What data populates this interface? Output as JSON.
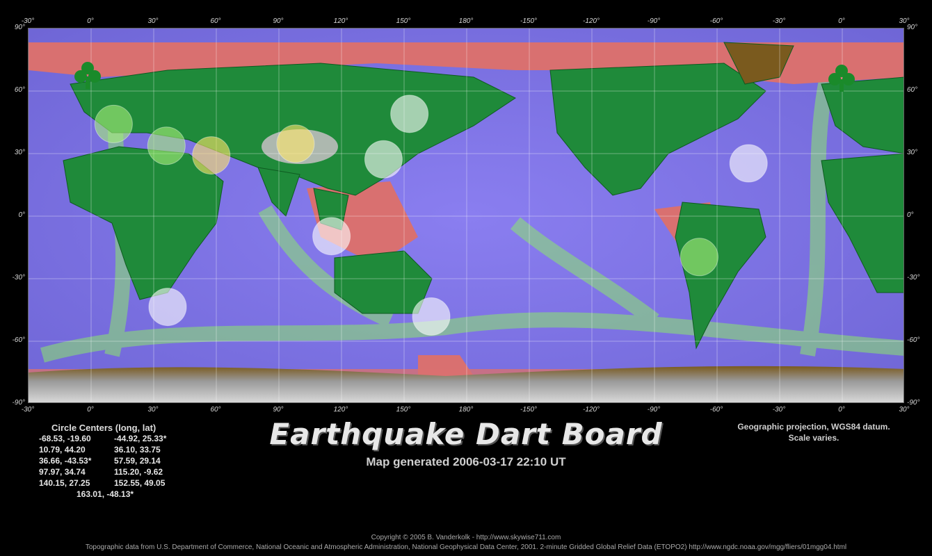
{
  "map": {
    "top_ticks": [
      "-30°",
      "0°",
      "30°",
      "60°",
      "90°",
      "120°",
      "150°",
      "180°",
      "-150°",
      "-120°",
      "-90°",
      "-60°",
      "-30°",
      "0°",
      "30°"
    ],
    "side_ticks": [
      "90°",
      "60°",
      "30°",
      "0°",
      "-30°",
      "-60°",
      "-90°"
    ],
    "circles": [
      {
        "long": -68.53,
        "lat": -19.6,
        "color": "green"
      },
      {
        "long": -44.92,
        "lat": 25.33,
        "color": "white"
      },
      {
        "long": 10.79,
        "lat": 44.2,
        "color": "green"
      },
      {
        "long": 36.1,
        "lat": 33.75,
        "color": "green"
      },
      {
        "long": 36.66,
        "lat": -43.53,
        "color": "white"
      },
      {
        "long": 57.59,
        "lat": 29.14,
        "color": "yellow"
      },
      {
        "long": 97.97,
        "lat": 34.74,
        "color": "yellow"
      },
      {
        "long": 115.2,
        "lat": -9.62,
        "color": "white"
      },
      {
        "long": 140.15,
        "lat": 27.25,
        "color": "white"
      },
      {
        "long": 152.55,
        "lat": 49.05,
        "color": "white"
      },
      {
        "long": 163.01,
        "lat": -48.13,
        "color": "white"
      }
    ],
    "colors": {
      "ocean": "#7c6ee0",
      "land": "#1f8a3a",
      "shelf": "#d97070",
      "ridge": "#8de86b",
      "ice": "#bdbdbd"
    }
  },
  "legend": {
    "title": "Circle Centers (long, lat)",
    "rows": [
      [
        "-68.53,  -19.60",
        "-44.92,  25.33*"
      ],
      [
        "10.79,  44.20",
        "36.10,  33.75"
      ],
      [
        "36.66,  -43.53*",
        "57.59,  29.14"
      ],
      [
        "97.97,  34.74",
        "115.20,  -9.62"
      ],
      [
        "140.15,  27.25",
        "152.55,  49.05"
      ]
    ],
    "last": "163.01,  -48.13*"
  },
  "title": "Earthquake Dart Board",
  "subtitle": "Map generated 2006-03-17 22:10 UT",
  "projection_note": [
    "Geographic projection, WGS84 datum.",
    "Scale varies."
  ],
  "copyright": "Copyright © 2005 B. Vanderkolk - http://www.skywise711.com",
  "topo_credit": "Topographic data from U.S. Department of Commerce, National Oceanic and Atmospheric Administration, National Geophysical Data Center, 2001. 2-minute Gridded Global Relief Data (ETOPO2) http://www.ngdc.noaa.gov/mgg/fliers/01mgg04.html"
}
